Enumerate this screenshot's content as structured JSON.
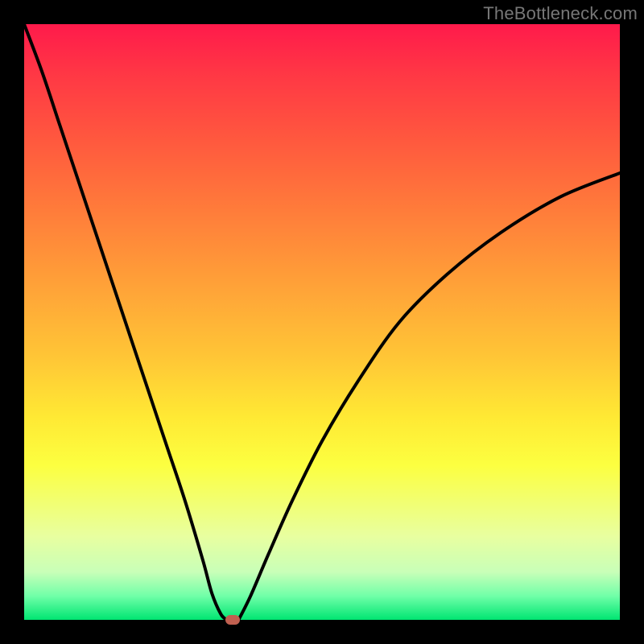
{
  "watermark": "TheBottleneck.com",
  "colors": {
    "frame": "#000000",
    "curve_stroke": "#000000",
    "marker_fill": "#c06050"
  },
  "chart_data": {
    "type": "line",
    "title": "",
    "xlabel": "",
    "ylabel": "",
    "xlim": [
      0,
      100
    ],
    "ylim": [
      0,
      100
    ],
    "grid": false,
    "legend": false,
    "series": [
      {
        "name": "left-branch",
        "x": [
          0,
          3,
          6,
          9,
          12,
          15,
          18,
          21,
          24,
          27,
          30,
          31.5,
          33,
          34
        ],
        "y": [
          100,
          92,
          83,
          74,
          65,
          56,
          47,
          38,
          29,
          20,
          10,
          4.5,
          1,
          0
        ]
      },
      {
        "name": "right-branch",
        "x": [
          36,
          38,
          41,
          45,
          50,
          56,
          63,
          71,
          80,
          90,
          100
        ],
        "y": [
          0,
          4,
          11,
          20,
          30,
          40,
          50,
          58,
          65,
          71,
          75
        ]
      },
      {
        "name": "floor",
        "x": [
          34,
          36
        ],
        "y": [
          0,
          0
        ]
      }
    ],
    "marker": {
      "x": 35,
      "y": 0
    },
    "annotations": []
  }
}
